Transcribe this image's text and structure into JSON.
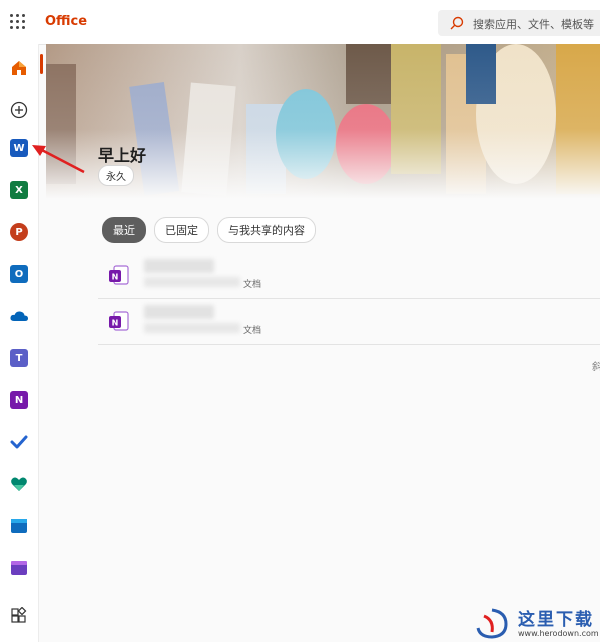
{
  "topbar": {
    "brand": "Office",
    "search_placeholder": "搜索应用、文件、模板等"
  },
  "sidebar": {
    "items": [
      {
        "name": "home-icon",
        "active": true
      },
      {
        "name": "create-icon"
      },
      {
        "name": "word-icon",
        "letter": "W",
        "color": "#185abd"
      },
      {
        "name": "excel-icon",
        "letter": "X",
        "color": "#107c41"
      },
      {
        "name": "powerpoint-icon",
        "letter": "P",
        "color": "#c43e1c"
      },
      {
        "name": "outlook-icon",
        "letter": "O",
        "color": "#0f6cbd"
      },
      {
        "name": "onedrive-icon",
        "color": "#0364b8"
      },
      {
        "name": "teams-icon",
        "letter": "T",
        "color": "#5b5fc7"
      },
      {
        "name": "onenote-icon",
        "letter": "N",
        "color": "#7719aa"
      },
      {
        "name": "todo-icon",
        "color": "#2564cf"
      },
      {
        "name": "family-safety-icon",
        "color": "#00876f"
      },
      {
        "name": "calendar-icon",
        "color": "#0f6cbd"
      },
      {
        "name": "clipchamp-icon",
        "color": "#6b3ebf"
      },
      {
        "name": "all-apps-icon"
      }
    ]
  },
  "hero": {
    "greeting": "早上好",
    "badge": "永久"
  },
  "tabs": [
    {
      "label": "最近",
      "active": true
    },
    {
      "label": "已固定"
    },
    {
      "label": "与我共享的内容"
    }
  ],
  "files": [
    {
      "type_suffix": "文档",
      "app": "onenote"
    },
    {
      "type_suffix": "文档",
      "app": "onenote"
    }
  ],
  "edge_char": "斜",
  "watermark": {
    "text": "这里下载",
    "url": "www.herodown.com"
  }
}
